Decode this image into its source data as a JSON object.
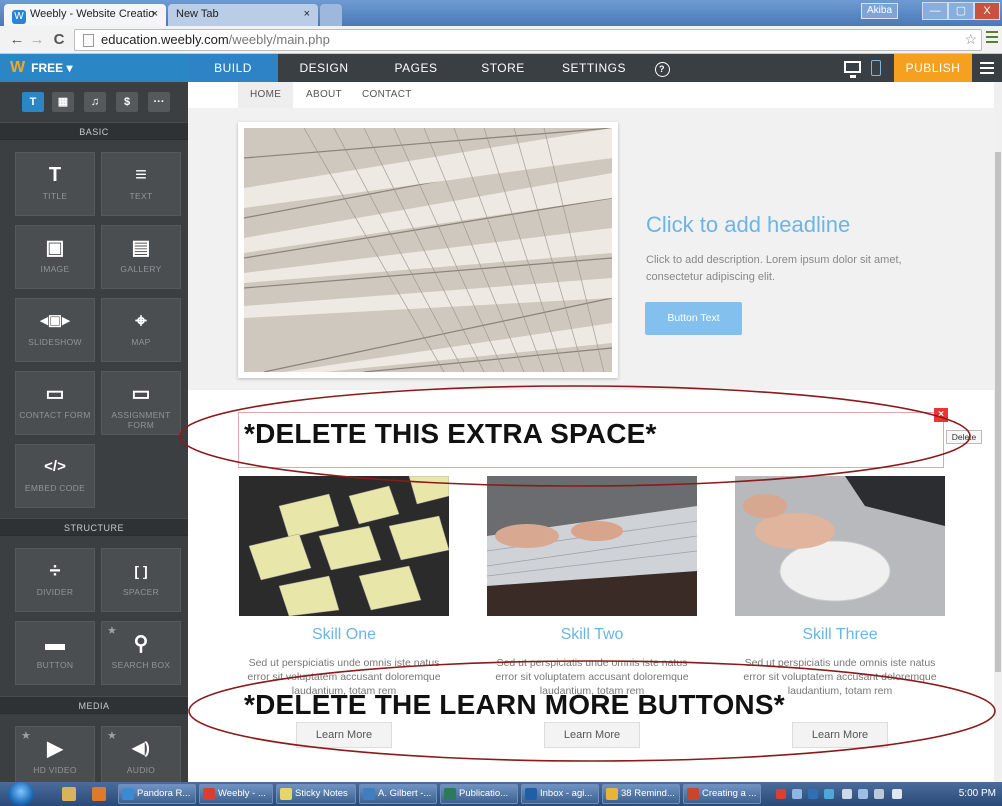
{
  "browser": {
    "tabs": [
      {
        "title": "Weebly - Website Creatio",
        "close": "×",
        "icon": "W"
      },
      {
        "title": "New Tab",
        "close": "×"
      }
    ],
    "window_user": "Akiba",
    "window_buttons": {
      "min": "—",
      "max": "▢",
      "close": "X"
    },
    "url_host": "education.weebly.com",
    "url_path": "/weebly/main.php"
  },
  "weebly": {
    "plan_label": "FREE ▾",
    "logo": "W",
    "nav": [
      "BUILD",
      "DESIGN",
      "PAGES",
      "STORE",
      "SETTINGS"
    ],
    "help": "?",
    "publish": "PUBLISH"
  },
  "sidebar": {
    "tabs": [
      "T",
      "▦",
      "♫",
      "$",
      "···"
    ],
    "sections": {
      "basic": "BASIC",
      "structure": "STRUCTURE",
      "media": "MEDIA"
    },
    "basic": [
      {
        "label": "TITLE",
        "icon": "T"
      },
      {
        "label": "TEXT",
        "icon": "≡"
      },
      {
        "label": "IMAGE",
        "icon": "▣"
      },
      {
        "label": "GALLERY",
        "icon": "▤"
      },
      {
        "label": "SLIDESHOW",
        "icon": "◂▣▸"
      },
      {
        "label": "MAP",
        "icon": "⌖"
      },
      {
        "label": "CONTACT FORM",
        "icon": "▭"
      },
      {
        "label": "ASSIGNMENT FORM",
        "icon": "▭"
      },
      {
        "label": "EMBED CODE",
        "icon": "</>"
      }
    ],
    "structure": [
      {
        "label": "DIVIDER",
        "icon": "÷"
      },
      {
        "label": "SPACER",
        "icon": "[ ]"
      },
      {
        "label": "BUTTON",
        "icon": "▬"
      },
      {
        "label": "SEARCH BOX",
        "icon": "⚲",
        "star": "★"
      }
    ],
    "media": [
      {
        "label": "HD VIDEO",
        "icon": "▶",
        "star": "★"
      },
      {
        "label": "AUDIO",
        "icon": "◀)",
        "star": "★"
      }
    ]
  },
  "site": {
    "nav": [
      "HOME",
      "ABOUT",
      "CONTACT"
    ],
    "headline": "Click to add headline",
    "description": "Click to add description. Lorem ipsum dolor sit amet, consectetur adipiscing elit.",
    "button": "Button Text",
    "delete_tip": "Delete",
    "delete_x": "×",
    "skills": [
      {
        "title": "Skill One",
        "text": "Sed ut perspiciatis unde omnis iste natus error sit voluptatem accusant doloremque laudantium, totam rem",
        "button": "Learn More"
      },
      {
        "title": "Skill Two",
        "text": "Sed ut perspiciatis unde omnis iste natus error sit voluptatem accusant doloremque laudantium, totam rem",
        "button": "Learn More"
      },
      {
        "title": "Skill Three",
        "text": "Sed ut perspiciatis unde omnis iste natus error sit voluptatem accusant doloremque laudantium, totam rem",
        "button": "Learn More"
      }
    ]
  },
  "annotations": {
    "note1": "*DELETE THIS EXTRA SPACE*",
    "note2": "*DELETE THE LEARN MORE BUTTONS*"
  },
  "taskbar": {
    "items": [
      "Pandora R...",
      "Weebly - ...",
      "Sticky Notes",
      "A. Gilbert -...",
      "Publicatio...",
      "Inbox - agi...",
      "38 Remind...",
      "Creating a ..."
    ],
    "clock": "5:00 PM"
  },
  "colors": {
    "weebly_blue": "#2b86c6",
    "publish": "#f5a11f",
    "annotation_red": "#8b1a1a",
    "link_blue": "#6bb5e6"
  }
}
